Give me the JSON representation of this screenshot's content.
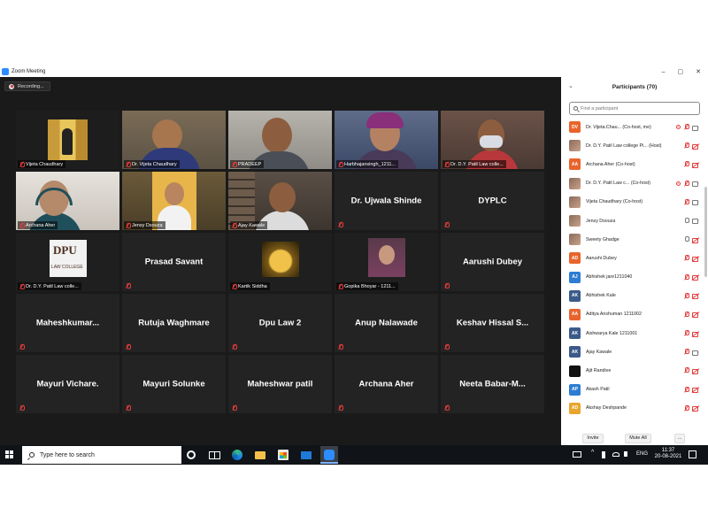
{
  "window": {
    "title": "Zoom Meeting",
    "controls": [
      "–",
      "▢",
      "✕"
    ]
  },
  "recording": {
    "label": "Recording..."
  },
  "tiles": [
    {
      "label": "Vijeta Chaudhary",
      "type": "video",
      "style": "v1"
    },
    {
      "label": "Dr. Vijeta Chaudhary",
      "type": "video",
      "style": "v2"
    },
    {
      "label": "PRADEEP",
      "type": "video",
      "style": "v3"
    },
    {
      "label": "Harbhajansingh_1211...",
      "type": "video",
      "style": "v4"
    },
    {
      "label": "Dr. D.Y. Patil Law colle...",
      "type": "video",
      "style": "v5"
    },
    {
      "label": "Archana Aher",
      "type": "video",
      "style": "v6"
    },
    {
      "label": "Jensy Dsouza",
      "type": "video",
      "style": "v7",
      "active": true
    },
    {
      "label": "Ajay Kawale",
      "type": "video",
      "style": "v8"
    },
    {
      "name": "Dr. Ujwala Shinde",
      "type": "name"
    },
    {
      "name": "DYPLC",
      "type": "name"
    },
    {
      "label": "Dr. D.Y. Patil Law colle...",
      "type": "video",
      "style": "v9"
    },
    {
      "name": "Prasad Savant",
      "type": "name"
    },
    {
      "label": "Kartik Siddha",
      "type": "video",
      "style": "v10"
    },
    {
      "label": "Gopika Bhoyar - 1211...",
      "type": "video",
      "style": "v11"
    },
    {
      "name": "Aarushi Dubey",
      "type": "name"
    },
    {
      "name": "Maheshkumar...",
      "type": "name"
    },
    {
      "name": "Rutuja Waghmare",
      "type": "name"
    },
    {
      "name": "Dpu Law 2",
      "type": "name"
    },
    {
      "name": "Anup Nalawade",
      "type": "name"
    },
    {
      "name": "Keshav  Hissal  S...",
      "type": "name"
    },
    {
      "name": "Mayuri Vichare.",
      "type": "name"
    },
    {
      "name": "Mayuri Solunke",
      "type": "name"
    },
    {
      "name": "Maheshwar patil",
      "type": "name"
    },
    {
      "name": "Archana Aher",
      "type": "name"
    },
    {
      "name": "Neeta  Babar-M...",
      "type": "name"
    }
  ],
  "participants_panel": {
    "title": "Participants (70)",
    "search_placeholder": "Find a participant",
    "participants": [
      {
        "initials": "DV",
        "color": "#e8642c",
        "name": "Dr. Vijeta.Chau...  (Co-host, me)",
        "mic": "off",
        "cam": "on",
        "rec": true
      },
      {
        "initials": "",
        "avatar": "img",
        "name": "Dr. D.Y. Patil Law college Pi...  (Host)",
        "mic": "off",
        "cam": "off"
      },
      {
        "initials": "AA",
        "color": "#e8642c",
        "name": "Archana Aher  (Co-host)",
        "mic": "off",
        "cam": "off"
      },
      {
        "initials": "",
        "avatar": "img",
        "name": "Dr. D.Y. Patil Law c...  (Co-host)",
        "mic": "off",
        "cam": "on",
        "rec": true
      },
      {
        "initials": "",
        "avatar": "img",
        "name": "Vijeta Chaudhary  (Co-host)",
        "mic": "off",
        "cam": "on"
      },
      {
        "initials": "",
        "avatar": "img",
        "name": "Jensy Dsouza",
        "mic": "on",
        "cam": "on"
      },
      {
        "initials": "",
        "avatar": "img",
        "name": "Sweety Ghadge",
        "mic": "on",
        "cam": "off"
      },
      {
        "initials": "AD",
        "color": "#e8642c",
        "name": "Aarushi Dubey",
        "mic": "off",
        "cam": "off"
      },
      {
        "initials": "AJ",
        "color": "#2d7dd2",
        "name": "Abhishek jare1211040",
        "mic": "off",
        "cam": "off"
      },
      {
        "initials": "AK",
        "color": "#3a5a8a",
        "name": "Abhishek Kale",
        "mic": "off",
        "cam": "off"
      },
      {
        "initials": "AA",
        "color": "#e8642c",
        "name": "Aditya Anshuman 1211002",
        "mic": "off",
        "cam": "off"
      },
      {
        "initials": "AK",
        "color": "#3a5a8a",
        "name": "Aishwarya Kale 1211001",
        "mic": "off",
        "cam": "off"
      },
      {
        "initials": "AK",
        "color": "#3a5a8a",
        "name": "Ajay Kawale",
        "mic": "off",
        "cam": "on"
      },
      {
        "initials": "",
        "avatar": "black",
        "name": "Ajit Randive",
        "mic": "off",
        "cam": "off"
      },
      {
        "initials": "AP",
        "color": "#2d7dd2",
        "name": "Akash Patil",
        "mic": "off",
        "cam": "off"
      },
      {
        "initials": "AD",
        "color": "#e8a62c",
        "name": "Akshay Deshpande",
        "mic": "off",
        "cam": "off"
      }
    ],
    "footer": {
      "invite": "Invite",
      "mute_all": "Mute All",
      "more": "..."
    }
  },
  "taskbar": {
    "search_placeholder": "Type here to search",
    "lang": "ENG",
    "time": "11:37",
    "date": "20-08-2021"
  }
}
